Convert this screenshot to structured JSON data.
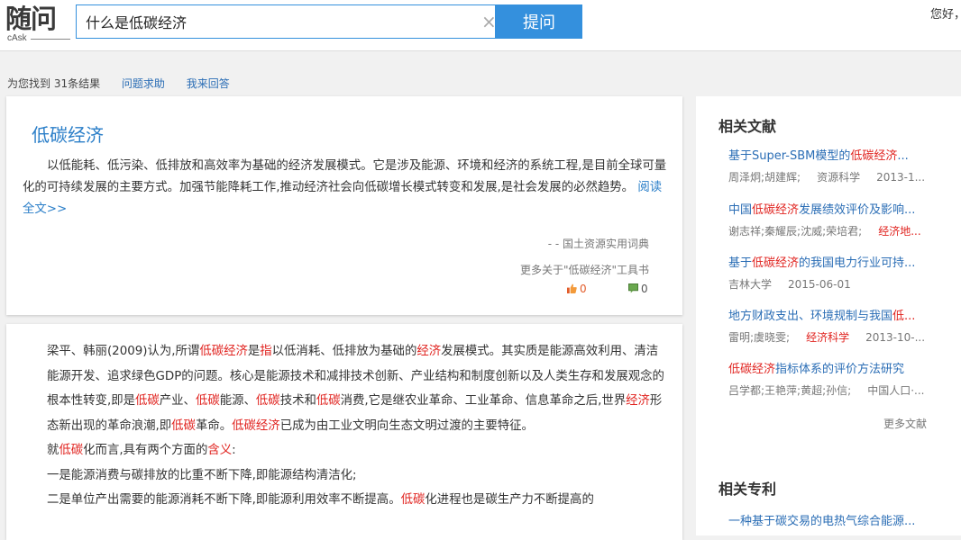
{
  "header": {
    "logo_main": "随问",
    "logo_sub": "cAsk",
    "search_value": "什么是低碳经济",
    "search_button": "提问",
    "greeting": "您好，"
  },
  "results_bar": {
    "count_text": "为您找到 31条结果",
    "link1": "问题求助",
    "link2": "我来回答"
  },
  "card1": {
    "title": "低碳经济",
    "text": "以低能耗、低污染、低排放和高效率为基础的经济发展模式。它是涉及能源、环境和经济的系统工程,是目前全球可量化的可持续发展的主要方式。加强节能降耗工作,推动经济社会向低碳增长模式转变和发展,是社会发展的必然趋势。",
    "read_more": "阅读全文>>",
    "source": "- - 国土资源实用词典",
    "more": "更多关于\"低碳经济\"工具书",
    "up_count": "0",
    "down_count": "0"
  },
  "card2": {
    "paragraphs": [
      [
        [
          "梁平、韩丽(2009)认为,所谓",
          false
        ],
        [
          "低碳经济",
          true
        ],
        [
          "是",
          false
        ],
        [
          "指",
          true
        ],
        [
          "以低消耗、低排放为基础的",
          false
        ],
        [
          "经济",
          true
        ],
        [
          "发展模式。其实质是能源高效利用、清洁能源开发、追求绿色GDP的问题。核心是能源技术和减排技术创新、产业结构和制度创新以及人类生存和发展观念的根本性转变,即是",
          false
        ],
        [
          "低碳",
          true
        ],
        [
          "产业、",
          false
        ],
        [
          "低碳",
          true
        ],
        [
          "能源、",
          false
        ],
        [
          "低碳",
          true
        ],
        [
          "技术和",
          false
        ],
        [
          "低碳",
          true
        ],
        [
          "消费,它是继农业革命、工业革命、信息革命之后,世界",
          false
        ],
        [
          "经济",
          true
        ],
        [
          "形态新出现的革命浪潮,即",
          false
        ],
        [
          "低碳",
          true
        ],
        [
          "革命。",
          false
        ],
        [
          "低碳经济",
          true
        ],
        [
          "已成为由工业文明向生态文明过渡的主要特征。",
          false
        ]
      ],
      [
        [
          "就",
          false
        ],
        [
          "低碳",
          true
        ],
        [
          "化而言,具有两个方面的",
          false
        ],
        [
          "含义",
          true
        ],
        [
          ":",
          false
        ]
      ],
      [
        [
          "一是能源消费与碳排放的比重不断下降,即能源结构清洁化;",
          false
        ]
      ],
      [
        [
          "二是单位产出需要的能源消耗不断下降,即能源利用效率不断提高。",
          false
        ],
        [
          "低碳",
          true
        ],
        [
          "化进程也是碳生产力不断提高的",
          false
        ]
      ]
    ]
  },
  "sidebar": {
    "docs_title": "相关文献",
    "docs": [
      {
        "title": [
          [
            "基于Super-SBM模型的",
            false
          ],
          [
            "低碳经济",
            true
          ],
          [
            "...",
            false
          ]
        ],
        "meta": [
          [
            "周泽炯;胡建辉;",
            false
          ],
          [
            "资源科学",
            false
          ],
          [
            "2013-1...",
            false
          ]
        ]
      },
      {
        "title": [
          [
            "中国",
            false
          ],
          [
            "低碳经济",
            true
          ],
          [
            "发展绩效评价及影响...",
            false
          ]
        ],
        "meta": [
          [
            "谢志祥;秦耀辰;沈威;荣培君;",
            false
          ],
          [
            "经济地...",
            true
          ]
        ]
      },
      {
        "title": [
          [
            "基于",
            false
          ],
          [
            "低碳经济",
            true
          ],
          [
            "的我国电力行业可持...",
            false
          ]
        ],
        "meta": [
          [
            "吉林大学",
            false
          ],
          [
            "2015-06-01",
            false
          ]
        ]
      },
      {
        "title": [
          [
            "地方财政支出、环境规制与我国",
            false
          ],
          [
            "低...",
            true
          ]
        ],
        "meta": [
          [
            "雷明;虞晓雯;",
            false
          ],
          [
            "经济科学",
            true
          ],
          [
            "2013-10-...",
            false
          ]
        ]
      },
      {
        "title": [
          [
            "低碳经济",
            true
          ],
          [
            "指标体系的评价方法研究",
            false
          ]
        ],
        "meta": [
          [
            "吕学都;王艳萍;黄超;孙信;",
            false
          ],
          [
            "中国人口·...",
            false
          ]
        ]
      }
    ],
    "docs_more": "更多文献",
    "patents_title": "相关专利",
    "patents": [
      {
        "title": [
          [
            "一种基于碳交易的电热气综合能源...",
            false
          ]
        ]
      }
    ]
  },
  "colors": {
    "accent": "#3490dd",
    "highlight": "#e0221e",
    "link": "#2a6db5"
  }
}
